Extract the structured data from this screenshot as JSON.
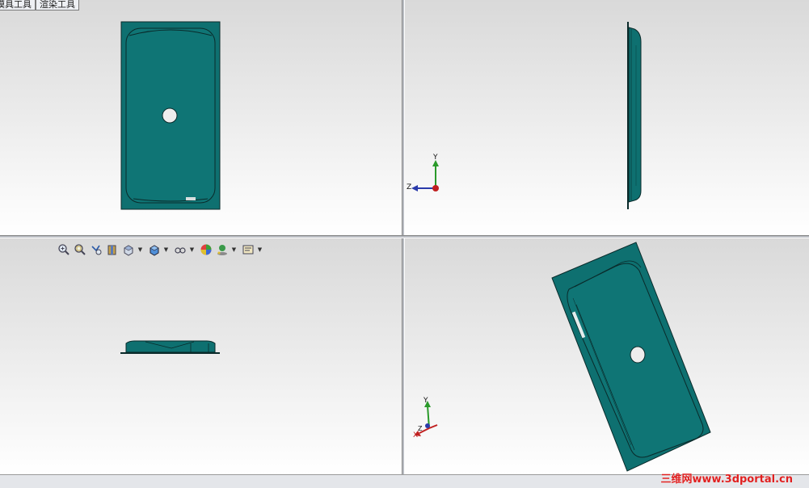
{
  "command_tabs": [
    {
      "label": "模具工具"
    },
    {
      "label": "渲染工具"
    }
  ],
  "heads_up_toolbar": {
    "buttons": [
      {
        "icon": "zoom-to-fit-icon",
        "has_dropdown": false
      },
      {
        "icon": "zoom-to-area-icon",
        "has_dropdown": false
      },
      {
        "icon": "previous-view-icon",
        "has_dropdown": false
      },
      {
        "icon": "section-view-icon",
        "has_dropdown": false
      },
      {
        "icon": "view-orientation-icon",
        "has_dropdown": true
      },
      {
        "icon": "display-style-icon",
        "has_dropdown": true
      },
      {
        "icon": "hide-show-items-icon",
        "has_dropdown": true
      },
      {
        "icon": "edit-appearance-icon",
        "has_dropdown": false
      },
      {
        "icon": "apply-scene-icon",
        "has_dropdown": true
      },
      {
        "icon": "view-settings-icon",
        "has_dropdown": true
      }
    ]
  },
  "viewports": {
    "front": {
      "name": "front-view"
    },
    "right": {
      "name": "right-view",
      "triad": {
        "axis_up": "Y",
        "axis_side": "Z"
      }
    },
    "top": {
      "name": "top-view"
    },
    "iso": {
      "name": "isometric-view",
      "triad": {
        "axis_up": "Y",
        "axis_side": "X",
        "axis_depth": "Z"
      }
    }
  },
  "model_color": "#0e7070",
  "watermark": "三维网www.3dportal.cn",
  "colors": {
    "model": "#0e7070",
    "model_edge": "#0a2a2a",
    "watermark": "#e02020",
    "axis_y": "#2a9a2a",
    "axis_z": "#2a3aaa",
    "axis_x": "#c02020"
  }
}
